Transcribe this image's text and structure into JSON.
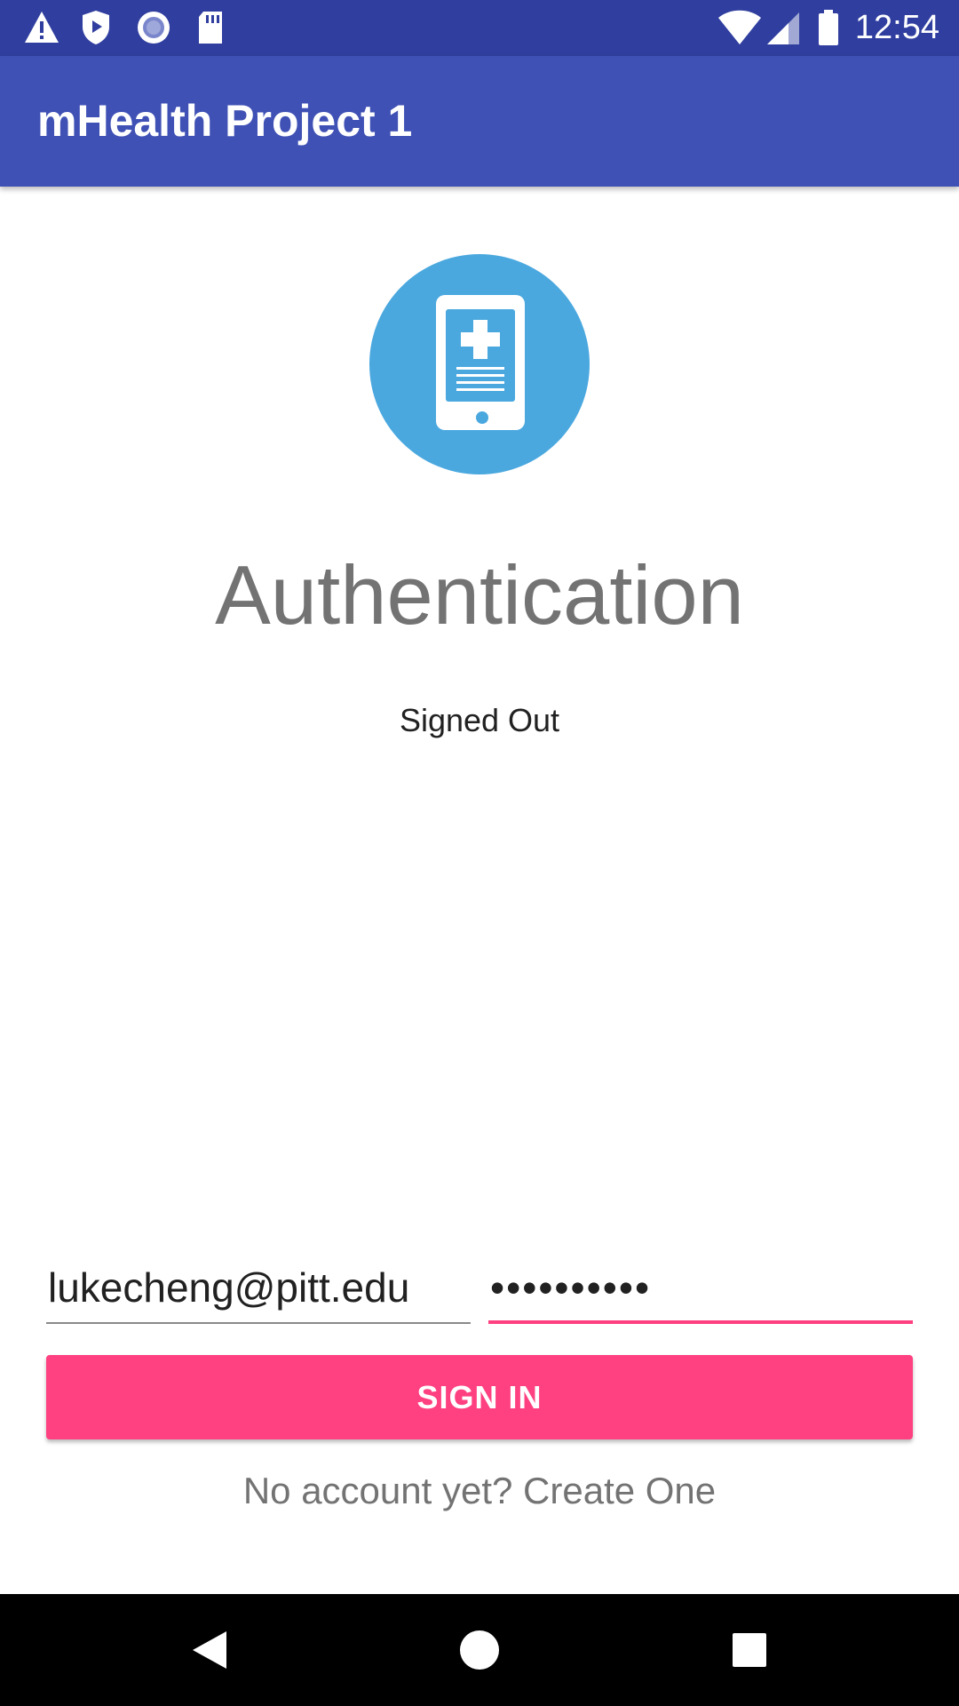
{
  "status_bar": {
    "time": "12:54",
    "icons": [
      "warning-icon",
      "shield-play-icon",
      "radio-circle-icon",
      "sd-card-icon",
      "wifi-icon",
      "cell-signal-icon",
      "battery-icon"
    ]
  },
  "app_bar": {
    "title": "mHealth Project 1"
  },
  "logo": {
    "icon": "mobile-health-icon",
    "circle_color": "#4aa8df"
  },
  "main": {
    "title": "Authentication",
    "status": "Signed Out"
  },
  "form": {
    "email_value": "lukecheng@pitt.edu",
    "password_value": "••••••••••",
    "sign_in_label": "SIGN IN",
    "create_account_text": "No account yet? Create One"
  },
  "nav_bar": {
    "icons": [
      "back-icon",
      "home-icon",
      "recents-icon"
    ]
  },
  "colors": {
    "status_bar": "#303f9f",
    "app_bar": "#3f51b5",
    "accent": "#ff4081",
    "logo_blue": "#4aa8df"
  }
}
